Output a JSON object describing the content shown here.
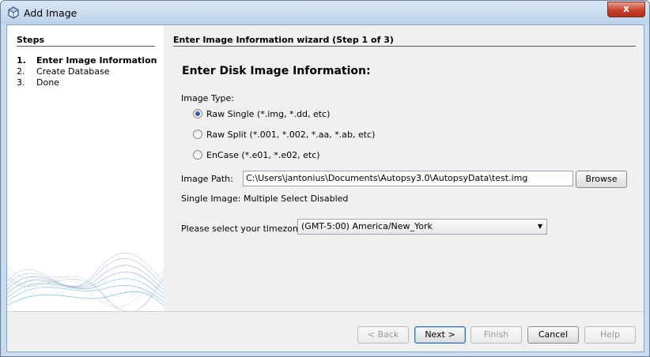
{
  "window": {
    "title": "Add Image",
    "close_label": "x"
  },
  "steps": {
    "title": "Steps",
    "items": [
      {
        "num": "1.",
        "label": "Enter Image Information",
        "active": true
      },
      {
        "num": "2.",
        "label": "Create Database",
        "active": false
      },
      {
        "num": "3.",
        "label": "Done",
        "active": false
      }
    ]
  },
  "wizard": {
    "title": "Enter Image Information wizard (Step 1 of 3)",
    "section_title": "Enter Disk Image Information:",
    "image_type_label": "Image Type:",
    "image_types": [
      {
        "label": "Raw Single (*.img, *.dd, etc)",
        "checked": true
      },
      {
        "label": "Raw Split (*.001, *.002, *.aa, *.ab, etc)",
        "checked": false
      },
      {
        "label": "EnCase (*.e01, *.e02, etc)",
        "checked": false
      }
    ],
    "image_path_label": "Image Path:",
    "image_path_value": "C:\\Users\\jantonius\\Documents\\Autopsy3.0\\AutopsyData\\test.img",
    "browse_label": "Browse",
    "single_image_note": "Single Image: Multiple Select Disabled",
    "timezone_label": "Please select your timezone:",
    "timezone_value": "(GMT-5:00) America/New_York"
  },
  "buttons": {
    "back": {
      "label": "< Back",
      "enabled": false
    },
    "next": {
      "label": "Next >",
      "enabled": true
    },
    "finish": {
      "label": "Finish",
      "enabled": false
    },
    "cancel": {
      "label": "Cancel",
      "enabled": true
    },
    "help": {
      "label": "Help",
      "enabled": false
    }
  }
}
